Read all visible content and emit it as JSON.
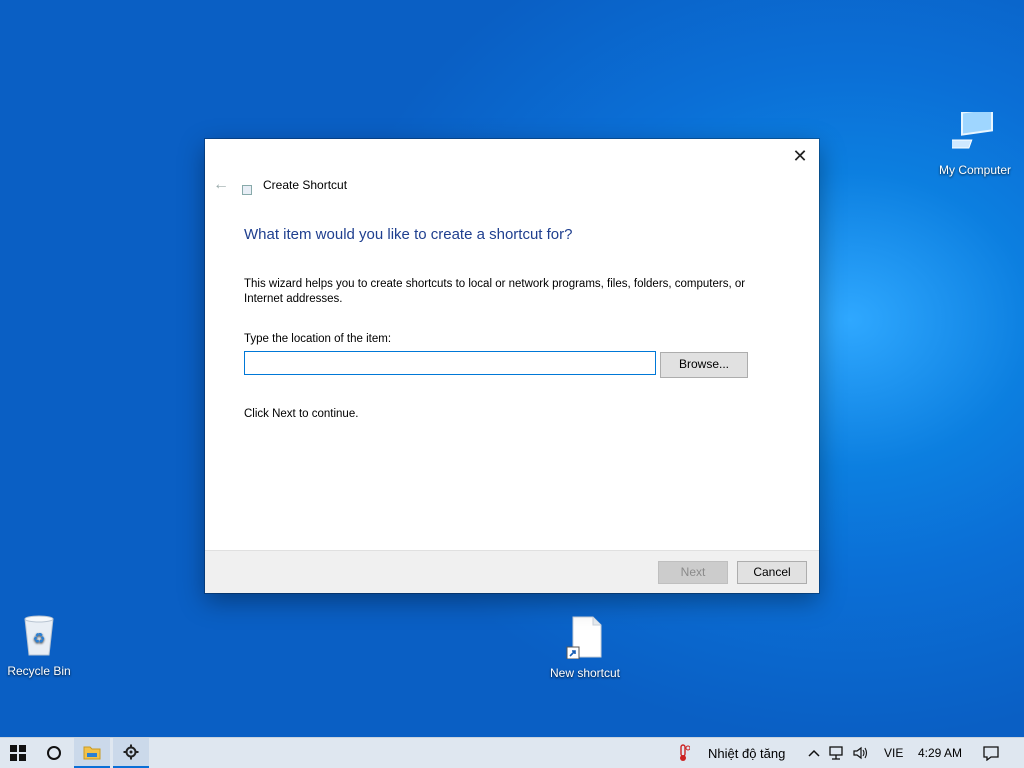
{
  "desktop": {
    "icons": [
      {
        "label": "My Computer"
      },
      {
        "label": "Recycle Bin"
      },
      {
        "label": "New shortcut"
      }
    ]
  },
  "dialog": {
    "window_title": "Create Shortcut",
    "heading": "What item would you like to create a shortcut for?",
    "description": "This wizard helps you to create shortcuts to local or network programs, files, folders, computers, or Internet addresses.",
    "location_label": "Type the location of the item:",
    "location_value": "",
    "browse_label": "Browse...",
    "continue_text": "Click Next to continue.",
    "next_label": "Next",
    "cancel_label": "Cancel",
    "close_glyph": "✕",
    "back_glyph": "←"
  },
  "taskbar": {
    "weather_text": "Nhiệt độ tăng",
    "language": "VIE",
    "time": "4:29 AM"
  },
  "colors": {
    "accent": "#0078d7",
    "heading": "#1f3f8f",
    "desktop_bg": "#0b6fd6"
  }
}
